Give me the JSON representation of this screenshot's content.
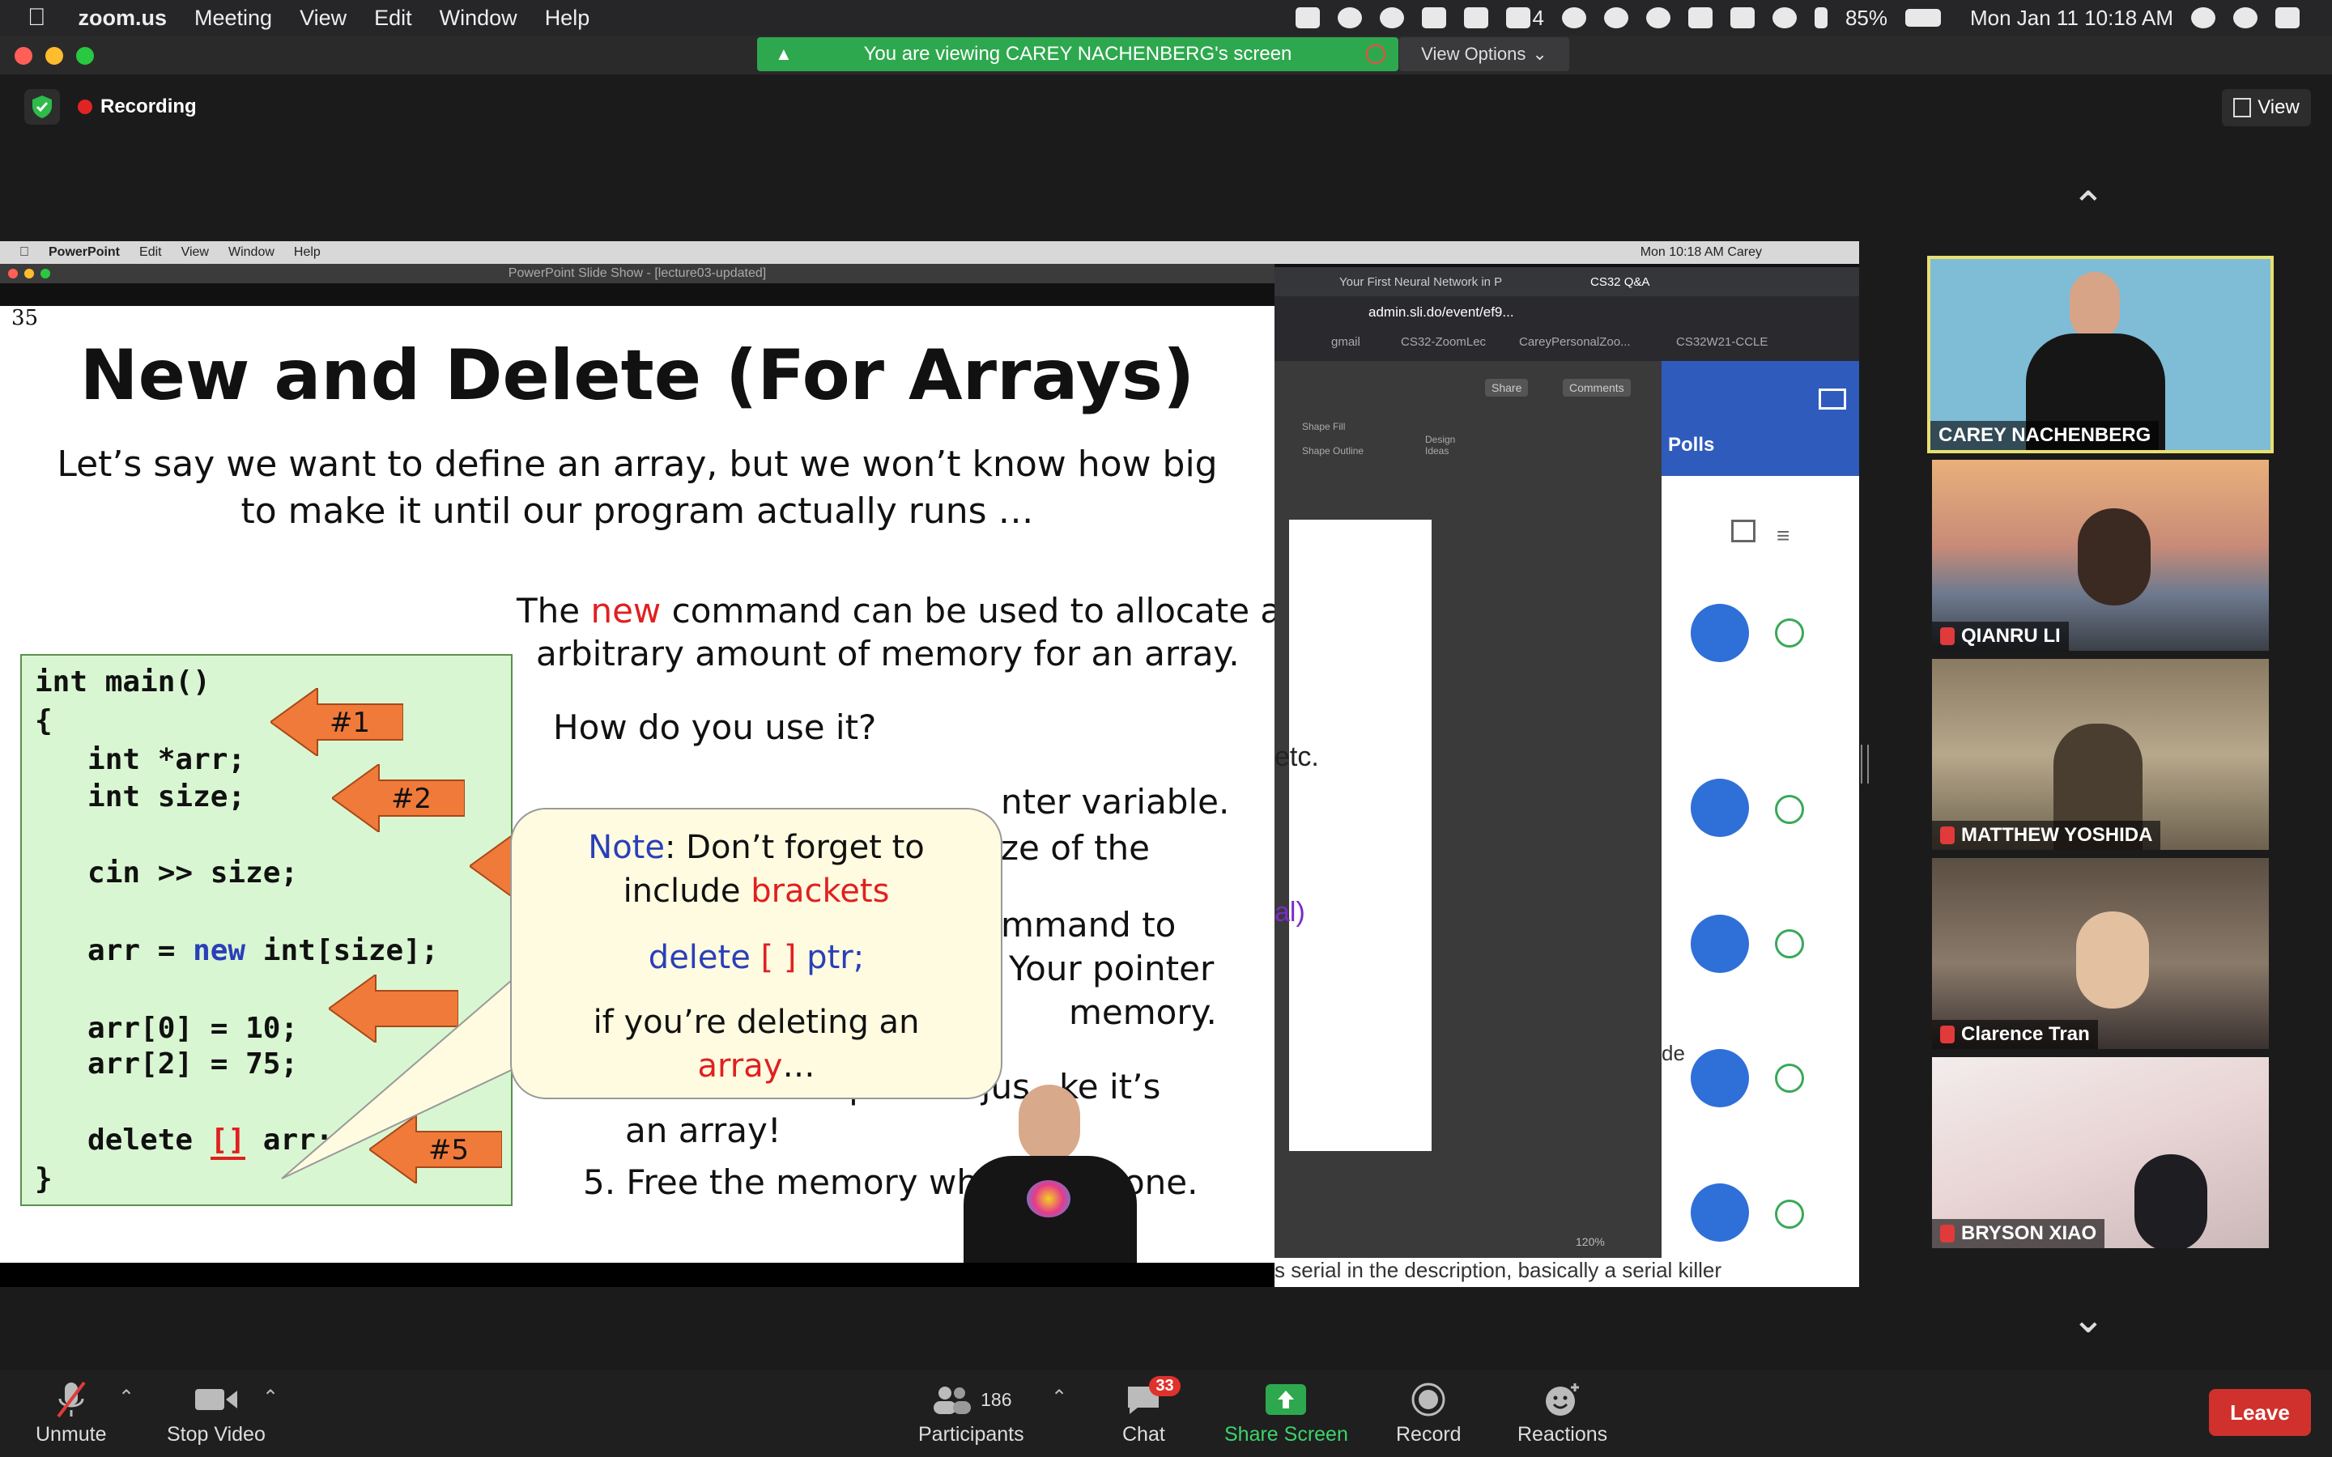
{
  "menubar": {
    "app": "zoom.us",
    "items": [
      "Meeting",
      "View",
      "Edit",
      "Window",
      "Help"
    ],
    "battery": "85%",
    "clock": "Mon Jan 11  10:18 AM",
    "badge_count": "4"
  },
  "banner": {
    "text": "You are viewing CAREY NACHENBERG's screen",
    "view_options": "View Options"
  },
  "top": {
    "recording": "Recording",
    "view": "View"
  },
  "shared_screen": {
    "mac_menu": [
      "PowerPoint",
      "Edit",
      "View",
      "Window",
      "Help"
    ],
    "mac_right": "Mon 10:18 AM   Carey",
    "ppt_window_title": "PowerPoint Slide Show - [lecture03-updated]",
    "slide": {
      "number": "35",
      "title": "New and Delete (For Arrays)",
      "intro_line1": "Let’s say we want to define an array, but we won’t know how big",
      "intro_line2": "to make it until our program actually runs …",
      "new_pre": "The ",
      "new_kw": "new",
      "new_post": " command can be used to allocate an",
      "new_line2": "arbitrary amount of memory for an array.",
      "how": "How do you use it?",
      "partial1": "nter variable.",
      "partial2": "ze of the",
      "partial3": "mmand to",
      "partial4": "Your pointer",
      "partial5": "memory.",
      "step4_line1": "4. Now use the pointer jus",
      "step4_line1b": "ke it’s",
      "step4_line2": "an array!",
      "step5": "5. Free the memory wh",
      "step5b": "one.",
      "code": [
        "int main()",
        "{",
        "   int *arr;",
        "   int size;",
        "",
        "   cin >> size;",
        "",
        "   arr = new int[size];",
        "",
        "   arr[0] = 10;",
        "   arr[2] = 75;",
        "",
        "   delete [] arr;",
        "}"
      ],
      "arrows": [
        "#1",
        "#2",
        "#5"
      ],
      "note_label": "Note",
      "note_text": ": Don’t forget to",
      "note_line2_pre": "include ",
      "note_line2_kw": "brackets",
      "note_code_a": "delete ",
      "note_code_b": "[ ]",
      "note_code_c": " ptr;",
      "note_line4": "if you’re deleting an",
      "note_line5_kw": "array",
      "note_line5_post": "…"
    },
    "browser": {
      "tab1": "Your First Neural Network in P",
      "tab2": "CS32 Q&A",
      "url": "admin.sli.do/event/ef9...",
      "bookmarks": [
        "gmail",
        "CS32-ZoomLec",
        "CareyPersonalZoo...",
        "CS32W21-CCLE"
      ],
      "share": "Share",
      "comments": "Comments",
      "shape_fill": "Shape Fill",
      "shape_outline": "Shape Outline",
      "design_ideas": "Design Ideas",
      "ppt_text_etc": "etc.",
      "ppt_text_al": "al)",
      "polls": "Polls",
      "fragment_de": "de",
      "zoom_pct": "120%",
      "caption": "s serial in the description, basically a serial killer"
    }
  },
  "participants": [
    {
      "name": "CAREY NACHENBERG",
      "active": true,
      "muted": false
    },
    {
      "name": "QIANRU LI",
      "active": false,
      "muted": true
    },
    {
      "name": "MATTHEW YOSHIDA",
      "active": false,
      "muted": true
    },
    {
      "name": "Clarence Tran",
      "active": false,
      "muted": true
    },
    {
      "name": "BRYSON XIAO",
      "active": false,
      "muted": true
    }
  ],
  "toolbar": {
    "unmute": "Unmute",
    "stop_video": "Stop Video",
    "participants": "Participants",
    "participant_count": "186",
    "chat": "Chat",
    "chat_badge": "33",
    "share_screen": "Share Screen",
    "record": "Record",
    "reactions": "Reactions",
    "leave": "Leave"
  },
  "colors": {
    "share_green": "#2ea84e",
    "leave_red": "#d0312d",
    "active_speaker": "#e8e070",
    "keyword_red": "#e02020",
    "keyword_blue": "#2a3fb8"
  }
}
